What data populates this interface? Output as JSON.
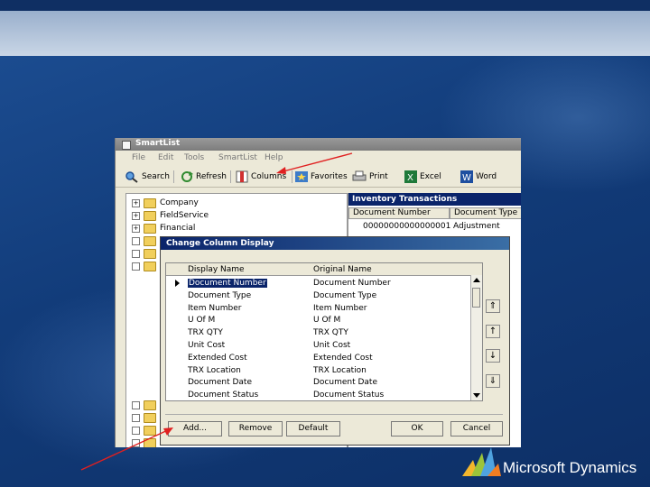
{
  "smartlist": {
    "title": "SmartList",
    "menu": [
      "File",
      "Edit",
      "Tools",
      "SmartList",
      "Help"
    ],
    "toolbar": {
      "search": "Search",
      "refresh": "Refresh",
      "columns": "Columns",
      "favorites": "Favorites",
      "print": "Print",
      "excel": "Excel",
      "word": "Word"
    },
    "tree": [
      {
        "label": "Company",
        "expander": "+"
      },
      {
        "label": "FieldService",
        "expander": "+"
      },
      {
        "label": "Financial",
        "expander": "+"
      }
    ],
    "results": {
      "title": "Inventory Transactions",
      "columns": [
        "Document Number",
        "Document Type"
      ],
      "rows": [
        [
          "00000000000000001",
          "Adjustment"
        ]
      ]
    }
  },
  "dialog": {
    "title": "Change Column Display",
    "headers": [
      "Display Name",
      "Original Name"
    ],
    "rows": [
      [
        "Document Number",
        "Document Number"
      ],
      [
        "Document Type",
        "Document Type"
      ],
      [
        "Item Number",
        "Item Number"
      ],
      [
        "U Of M",
        "U Of M"
      ],
      [
        "TRX QTY",
        "TRX QTY"
      ],
      [
        "Unit Cost",
        "Unit Cost"
      ],
      [
        "Extended Cost",
        "Extended Cost"
      ],
      [
        "TRX Location",
        "TRX Location"
      ],
      [
        "Document Date",
        "Document Date"
      ],
      [
        "Document Status",
        "Document Status"
      ]
    ],
    "selected_row": 0,
    "buttons": {
      "add": "Add...",
      "remove": "Remove",
      "default": "Default",
      "ok": "OK",
      "cancel": "Cancel"
    }
  },
  "branding": {
    "logo_text": "Microsoft Dynamics"
  },
  "colors": {
    "annotation_arrow": "#e02020",
    "selection": "#0a246a",
    "background": "#123c7a"
  }
}
